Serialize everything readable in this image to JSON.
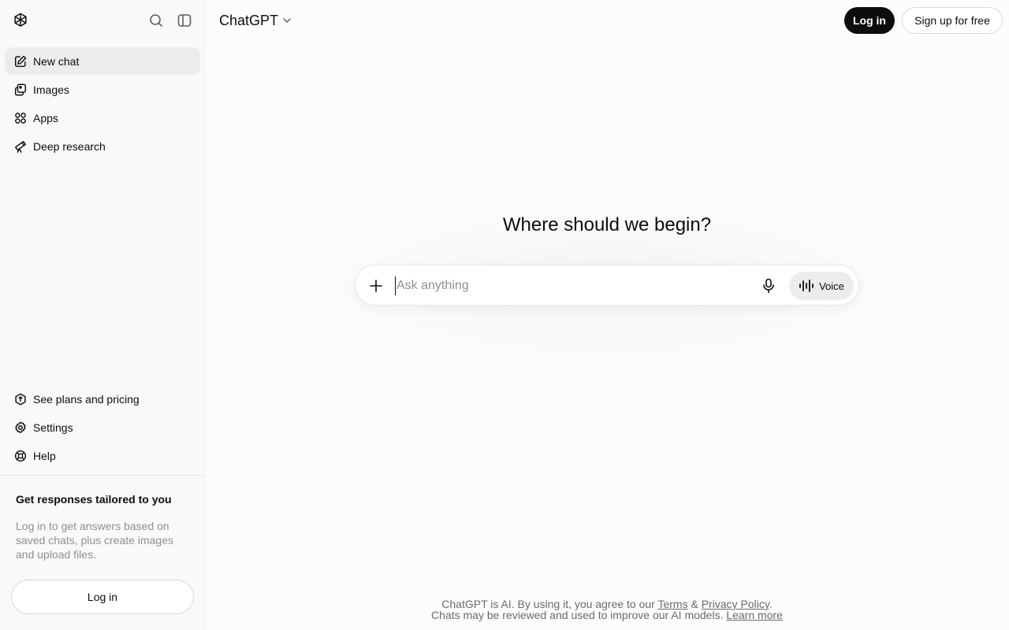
{
  "sidebar": {
    "logo_icon": "openai-logo-icon",
    "search_icon": "search-icon",
    "toggle_icon": "sidebar-toggle-icon",
    "nav": [
      {
        "label": "New chat",
        "icon": "edit-icon"
      },
      {
        "label": "Images",
        "icon": "images-icon"
      },
      {
        "label": "Apps",
        "icon": "apps-grid-icon"
      },
      {
        "label": "Deep research",
        "icon": "telescope-icon"
      }
    ],
    "bottom_nav": [
      {
        "label": "See plans and pricing",
        "icon": "plans-icon"
      },
      {
        "label": "Settings",
        "icon": "gear-icon"
      },
      {
        "label": "Help",
        "icon": "help-lifebuoy-icon"
      }
    ],
    "promo": {
      "title": "Get responses tailored to you",
      "text": "Log in to get answers based on saved chats, plus create images and upload files.",
      "login_label": "Log in"
    }
  },
  "header": {
    "model_name": "ChatGPT",
    "login_label": "Log in",
    "signup_label": "Sign up for free"
  },
  "main": {
    "headline": "Where should we begin?",
    "composer": {
      "placeholder": "Ask anything",
      "voice_label": "Voice"
    }
  },
  "footer": {
    "line1_prefix": "ChatGPT is AI. By using it, you agree to our ",
    "terms": "Terms",
    "amp": " & ",
    "privacy": "Privacy Policy",
    "line1_suffix": ".",
    "line2_prefix": "Chats may be reviewed and used to improve our AI models. ",
    "learn_more": "Learn more"
  }
}
